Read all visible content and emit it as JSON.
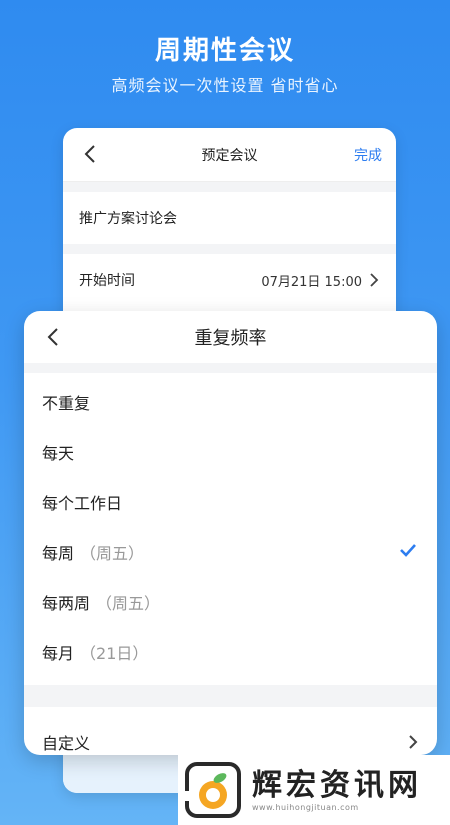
{
  "hero": {
    "title": "周期性会议",
    "subtitle": "高频会议一次性设置 省时省心"
  },
  "back_card": {
    "title": "预定会议",
    "done_label": "完成",
    "meeting_name": "推广方案讨论会",
    "start_label": "开始时间",
    "start_value": "07月21日 15:00"
  },
  "sheet": {
    "title": "重复频率",
    "options": [
      {
        "label": "不重复",
        "hint": ""
      },
      {
        "label": "每天",
        "hint": ""
      },
      {
        "label": "每个工作日",
        "hint": ""
      },
      {
        "label": "每周",
        "hint": "（周五）"
      },
      {
        "label": "每两周",
        "hint": "（周五）"
      },
      {
        "label": "每月",
        "hint": "（21日）"
      }
    ],
    "selected_index": 3,
    "custom_label": "自定义"
  },
  "watermark": {
    "brand": "辉宏资讯网",
    "url": "www.huihongjituan.com"
  },
  "colors": {
    "accent": "#2d7df0"
  },
  "icons": [
    "chevron-left-icon",
    "chevron-right-icon",
    "checkmark-icon",
    "fruit-logo-icon"
  ]
}
